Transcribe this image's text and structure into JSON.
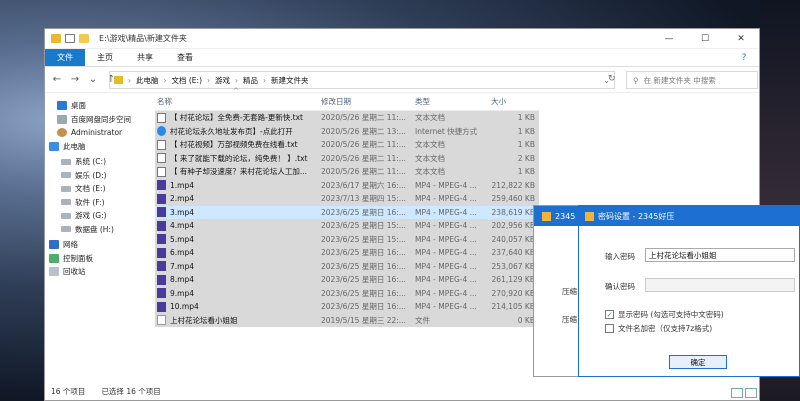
{
  "explorer": {
    "title": "E:\\游戏\\精品\\新建文件夹",
    "window_buttons": {
      "minimize": "—",
      "maximize": "☐",
      "close": "✕"
    },
    "ribbon_tabs": [
      "文件",
      "主页",
      "共享",
      "查看"
    ],
    "help": "?",
    "address_parts": [
      "此电脑",
      "文档 (E:)",
      "游戏",
      "精品",
      "新建文件夹"
    ],
    "address_sep": "›",
    "search_placeholder": "在 新建文件夹 中搜索",
    "sidebar": [
      {
        "icon": "desktop-icon",
        "label": "桌面"
      },
      {
        "icon": "cloud-icon",
        "label": "百度网盘同步空间"
      },
      {
        "icon": "user-icon",
        "label": "Administrator"
      },
      {
        "icon": "pc-icon",
        "label": "此电脑"
      },
      {
        "icon": "drive-icon",
        "label": "系统 (C:)"
      },
      {
        "icon": "drive-icon",
        "label": "娱乐 (D:)"
      },
      {
        "icon": "drive-icon",
        "label": "文档 (E:)"
      },
      {
        "icon": "drive-icon",
        "label": "软件 (F:)"
      },
      {
        "icon": "drive-icon",
        "label": "游戏 (G:)"
      },
      {
        "icon": "drive-icon",
        "label": "数据盘 (H:)"
      },
      {
        "icon": "network-icon",
        "label": "网络"
      },
      {
        "icon": "control-panel-icon",
        "label": "控制面板"
      },
      {
        "icon": "recycle-bin-icon",
        "label": "回收站"
      }
    ],
    "columns": [
      "名称",
      "修改日期",
      "类型",
      "大小"
    ],
    "files": [
      {
        "icon": "txt",
        "name": "【 村花论坛】全免费-无套路-更新快.txt",
        "date": "2020/5/26 星期二 11:...",
        "type": "文本文档",
        "size": "1 KB"
      },
      {
        "icon": "url",
        "name": "村花论坛永久地址发布页】-点此打开",
        "date": "2020/5/26 星期二 13:...",
        "type": "Internet 快捷方式",
        "size": "1 KB"
      },
      {
        "icon": "txt",
        "name": "【 村花视频】万部视频免费在线看.txt",
        "date": "2020/5/26 星期二 11:...",
        "type": "文本文档",
        "size": "1 KB"
      },
      {
        "icon": "txt",
        "name": "【 来了就能下载的论坛，纯免费！ 】.txt",
        "date": "2020/5/26 星期二 11:...",
        "type": "文本文档",
        "size": "2 KB"
      },
      {
        "icon": "txt",
        "name": "【 有种子却没速度？来村花论坛人工加...",
        "date": "2020/5/26 星期二 11:...",
        "type": "文本文档",
        "size": "1 KB"
      },
      {
        "icon": "mp4",
        "name": "1.mp4",
        "date": "2023/6/17 星期六 16:...",
        "type": "MP4 - MPEG-4 ...",
        "size": "212,822 KB"
      },
      {
        "icon": "mp4",
        "name": "2.mp4",
        "date": "2023/7/13 星期四 15:...",
        "type": "MP4 - MPEG-4 ...",
        "size": "259,460 KB"
      },
      {
        "icon": "mp4",
        "name": "3.mp4",
        "date": "2023/6/25 星期日 16:...",
        "type": "MP4 - MPEG-4 ...",
        "size": "238,619 KB"
      },
      {
        "icon": "mp4",
        "name": "4.mp4",
        "date": "2023/6/25 星期日 15:...",
        "type": "MP4 - MPEG-4 ...",
        "size": "202,956 KB"
      },
      {
        "icon": "mp4",
        "name": "5.mp4",
        "date": "2023/6/25 星期日 15:...",
        "type": "MP4 - MPEG-4 ...",
        "size": "240,057 KB"
      },
      {
        "icon": "mp4",
        "name": "6.mp4",
        "date": "2023/6/25 星期日 16:...",
        "type": "MP4 - MPEG-4 ...",
        "size": "237,640 KB"
      },
      {
        "icon": "mp4",
        "name": "7.mp4",
        "date": "2023/6/25 星期日 16:...",
        "type": "MP4 - MPEG-4 ...",
        "size": "253,067 KB"
      },
      {
        "icon": "mp4",
        "name": "8.mp4",
        "date": "2023/6/25 星期日 16:...",
        "type": "MP4 - MPEG-4 ...",
        "size": "261,129 KB"
      },
      {
        "icon": "mp4",
        "name": "9.mp4",
        "date": "2023/6/25 星期日 16:...",
        "type": "MP4 - MPEG-4 ...",
        "size": "270,920 KB"
      },
      {
        "icon": "mp4",
        "name": "10.mp4",
        "date": "2023/6/25 星期日 16:...",
        "type": "MP4 - MPEG-4 ...",
        "size": "214,105 KB"
      },
      {
        "icon": "plain",
        "name": "上村花论坛看小姐姐",
        "date": "2019/5/15 星期三 22:...",
        "type": "文件",
        "size": "0 KB"
      }
    ],
    "focused_row": 7,
    "status_count": "16 个项目",
    "status_selected": "已选择 16 个项目"
  },
  "bg_window": {
    "title": "2345",
    "labels": [
      "压缩",
      "压缩"
    ]
  },
  "password_dialog": {
    "title": "密码设置 - 2345好压",
    "enter_label": "输入密码",
    "enter_value": "上村花论坛看小姐姐",
    "confirm_label": "确认密码",
    "confirm_value": "",
    "show_password_checked": true,
    "show_password_label": "显示密码 (勾选可支持中文密码)",
    "encrypt_names_checked": false,
    "encrypt_names_label": "文件名加密（仅支持7z格式)",
    "ok_label": "确定",
    "checkmark": "✓"
  }
}
